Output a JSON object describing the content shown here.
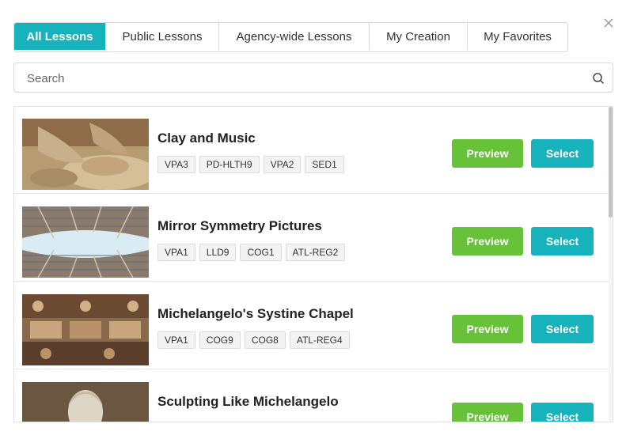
{
  "tabs": [
    {
      "label": "All Lessons",
      "active": true
    },
    {
      "label": "Public Lessons",
      "active": false
    },
    {
      "label": "Agency-wide Lessons",
      "active": false
    },
    {
      "label": "My Creation",
      "active": false
    },
    {
      "label": "My Favorites",
      "active": false
    }
  ],
  "search": {
    "placeholder": "Search",
    "value": ""
  },
  "actions": {
    "preview_label": "Preview",
    "select_label": "Select"
  },
  "lessons": [
    {
      "title": "Clay and Music",
      "tags": [
        "VPA3",
        "PD-HLTH9",
        "VPA2",
        "SED1"
      ],
      "thumbnail": "pottery-hands-image"
    },
    {
      "title": "Mirror Symmetry Pictures",
      "tags": [
        "VPA1",
        "LLD9",
        "COG1",
        "ATL-REG2"
      ],
      "thumbnail": "symmetric-architecture-image"
    },
    {
      "title": "Michelangelo's Systine Chapel",
      "tags": [
        "VPA1",
        "COG9",
        "COG8",
        "ATL-REG4"
      ],
      "thumbnail": "sistine-chapel-fresco-image"
    },
    {
      "title": "Sculpting Like Michelangelo",
      "tags": [],
      "thumbnail": "david-statue-image"
    }
  ],
  "colors": {
    "accent": "#17b3bd",
    "preview": "#67c23a"
  },
  "icons": {
    "close": "close-icon",
    "search": "search-icon"
  }
}
